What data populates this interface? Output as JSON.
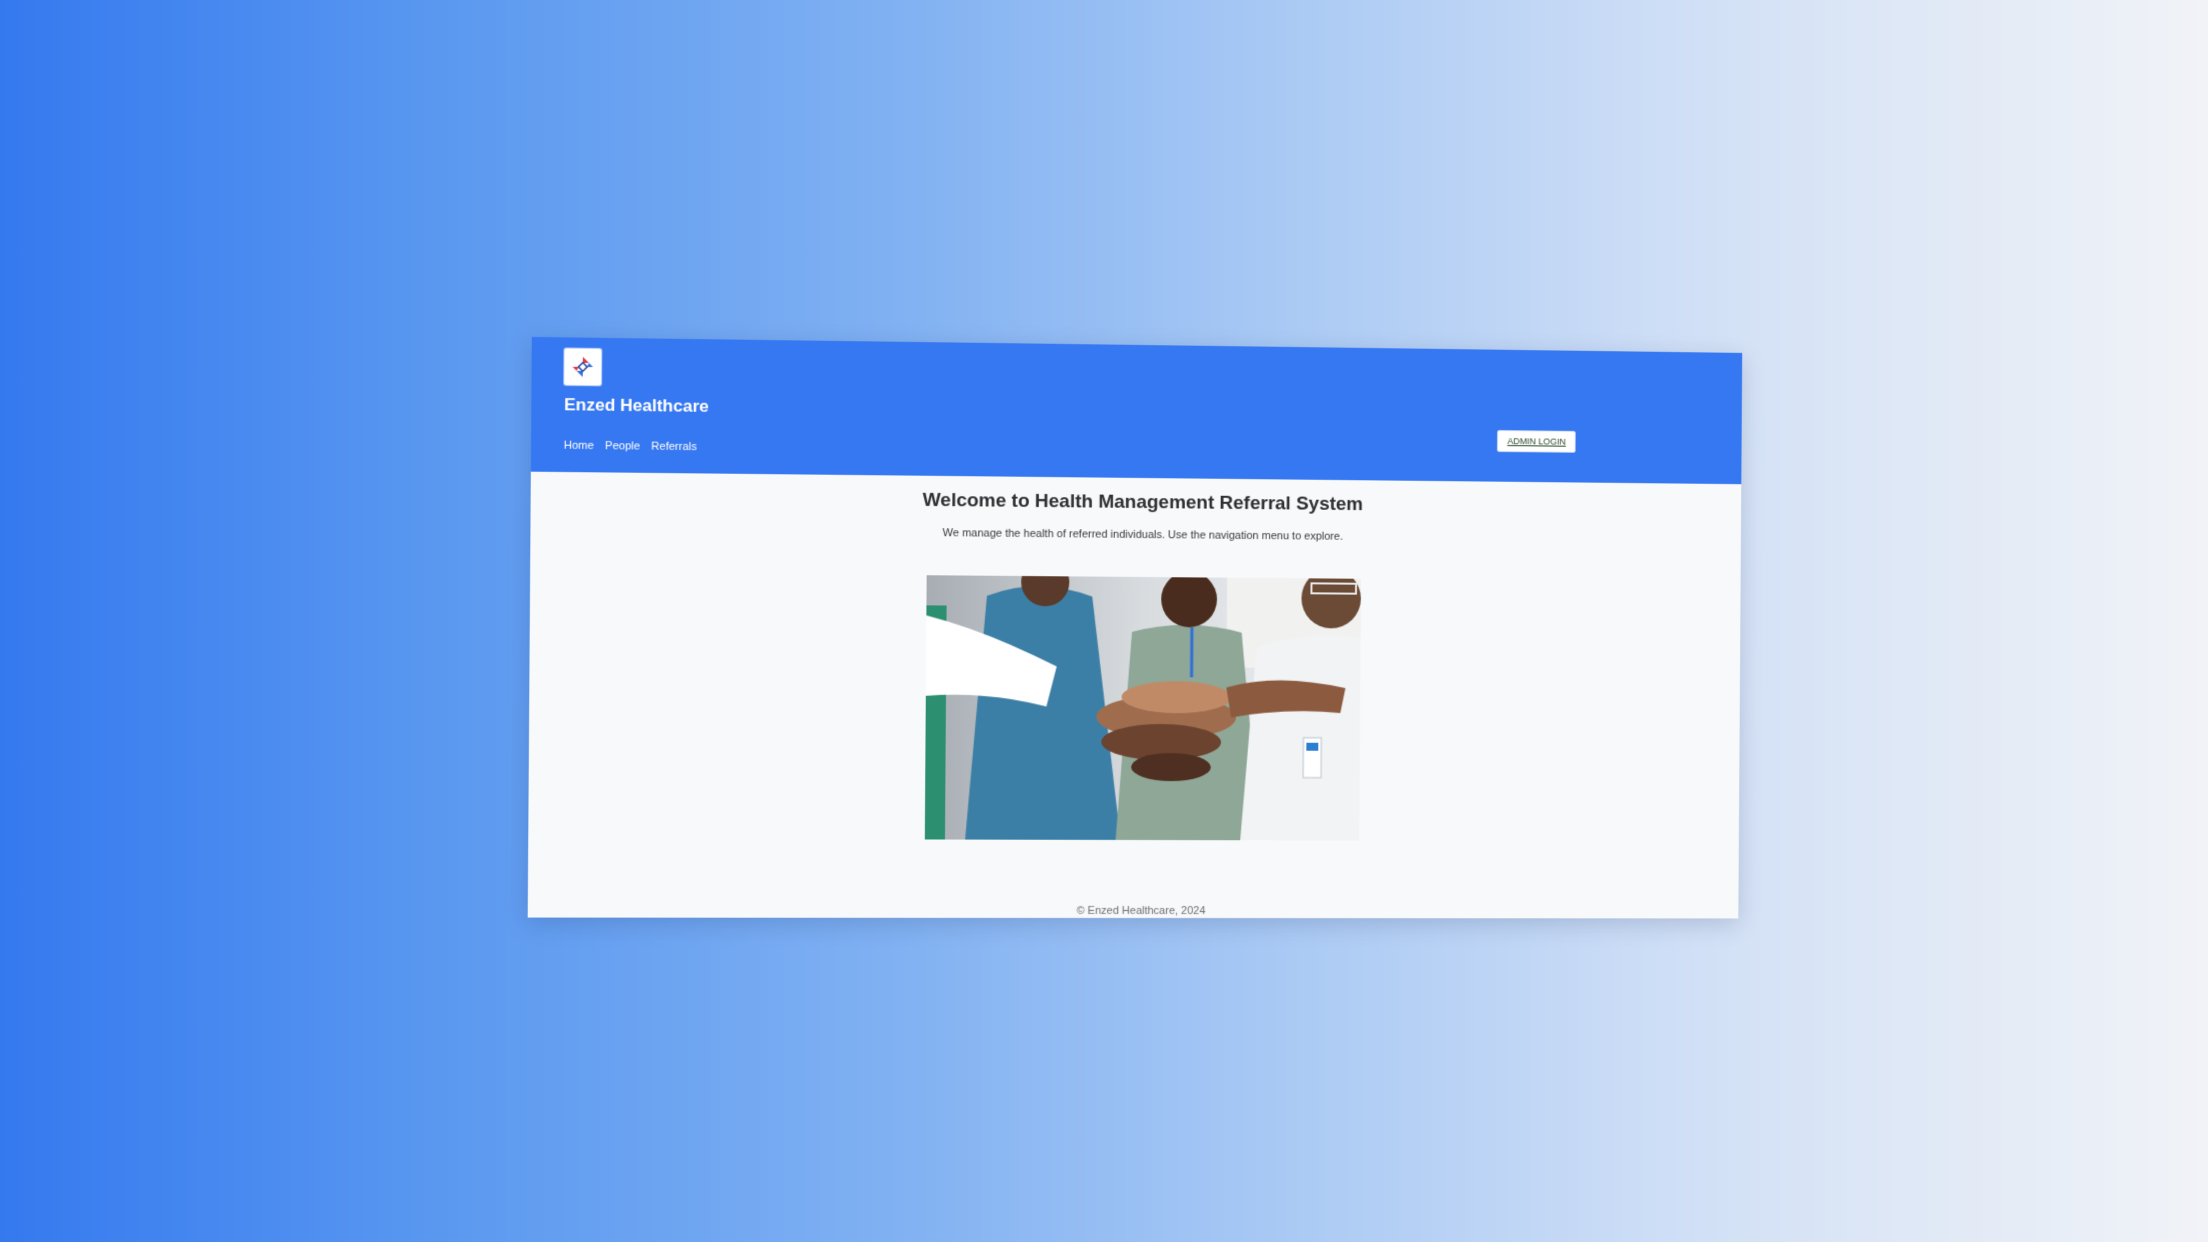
{
  "brand": {
    "name": "Enzed Healthcare"
  },
  "nav": {
    "items": [
      {
        "label": "Home"
      },
      {
        "label": "People"
      },
      {
        "label": "Referrals"
      }
    ],
    "admin_login_label": "ADMIN LOGIN"
  },
  "main": {
    "title": "Welcome to Health Management Referral System",
    "subtitle": "We manage the health of referred individuals. Use the navigation menu to explore.",
    "hero_image": "team-hands-stacked-photo"
  },
  "footer": {
    "text": "© Enzed Healthcare, 2024"
  },
  "colors": {
    "header": "#3678f2",
    "page_background": "#f7f9fb",
    "title_text": "#2f2f33"
  }
}
